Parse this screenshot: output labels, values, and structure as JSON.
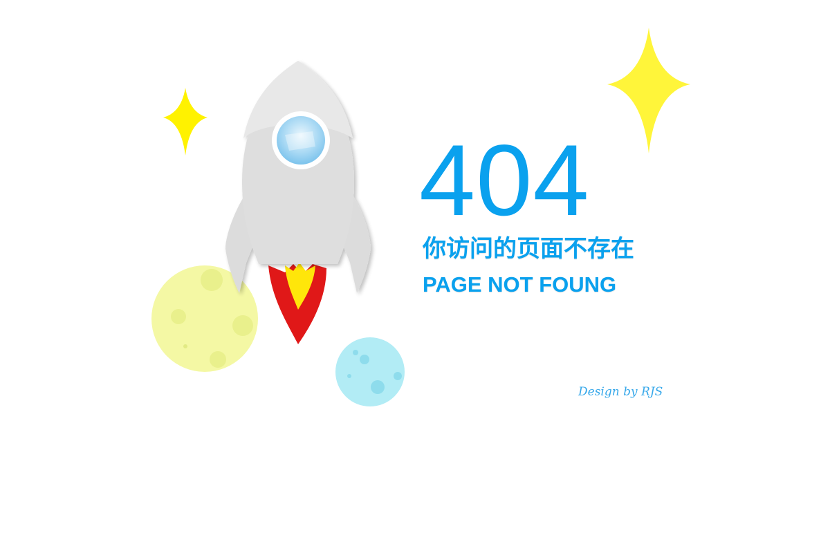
{
  "error": {
    "code": "404",
    "message_cn": "你访问的页面不存在",
    "message_en": "PAGE NOT FOUNG"
  },
  "credit": "Design by RJS",
  "illustration": {
    "elements": [
      "rocket",
      "flame",
      "yellow-planet",
      "blue-planet",
      "small-star",
      "large-star"
    ]
  },
  "colors": {
    "text": "#0aa1ee",
    "rocket_body": "#dcdcdc",
    "flame_outer": "#e01818",
    "flame_inner": "#ffe60a",
    "star": "#fff53a",
    "planet_yellow": "#f4f8a4",
    "planet_blue": "#b2ecf5"
  }
}
